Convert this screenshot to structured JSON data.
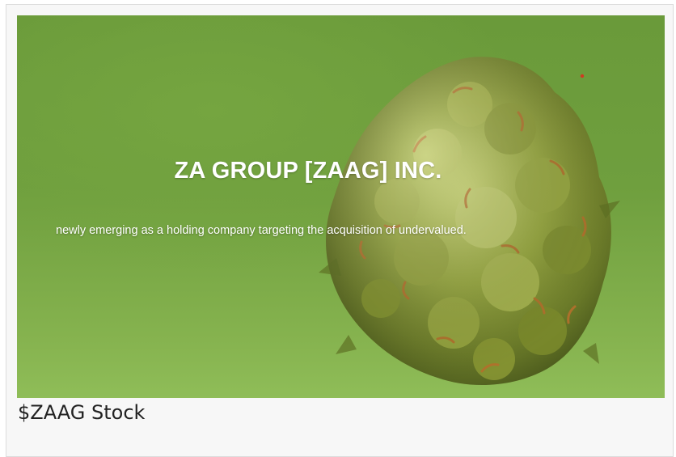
{
  "card": {
    "image": {
      "headline": "ZA GROUP [ZAAG] INC.",
      "subline": "newly emerging as a holding company targeting the acquisition of undervalued."
    },
    "caption": "$ZAAG Stock"
  },
  "colors": {
    "background_green": "#6f9f3e",
    "bud_green": "#8fae3e",
    "bud_orange": "#b5702c",
    "caption_text": "#222222"
  }
}
